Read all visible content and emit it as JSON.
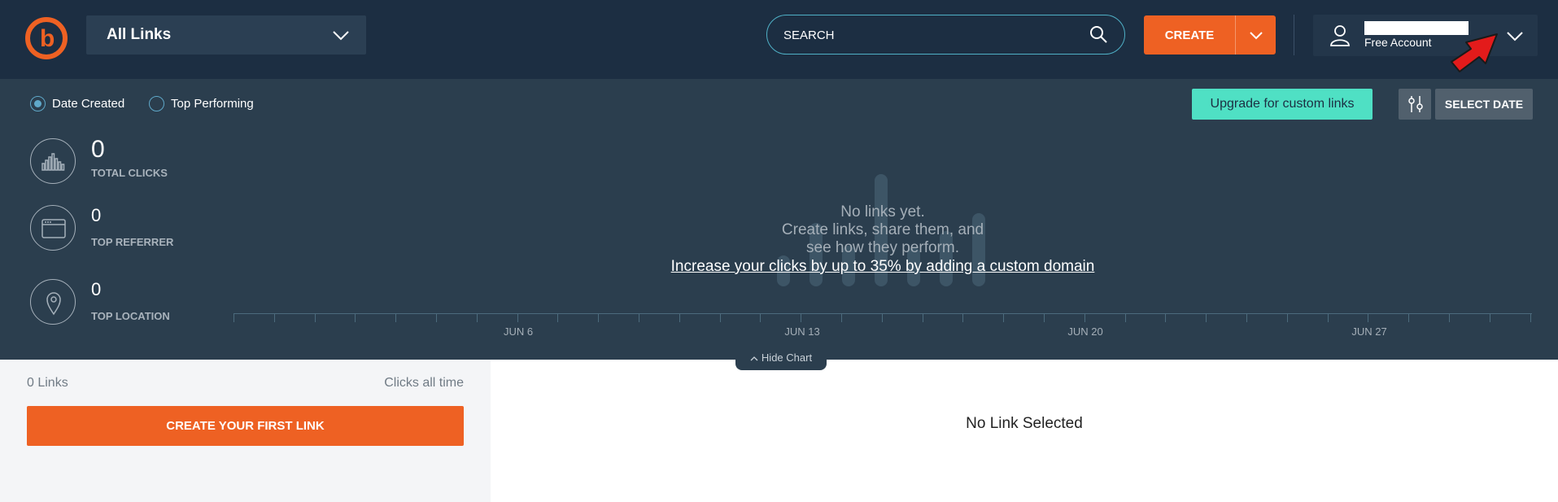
{
  "header": {
    "logo_icon": "bitly-logo-icon",
    "logo_letter": "b",
    "view_dropdown_label": "All Links",
    "search_placeholder": "SEARCH",
    "create_label": "CREATE",
    "account_plan": "Free Account"
  },
  "filters": {
    "date_created_label": "Date Created",
    "top_performing_label": "Top Performing",
    "selected": "Date Created",
    "upgrade_label": "Upgrade for custom links",
    "select_date_label": "SELECT DATE"
  },
  "stats": {
    "total_clicks_value": "0",
    "total_clicks_label": "TOTAL CLICKS",
    "top_referrer_value": "0",
    "top_referrer_label": "TOP REFERRER",
    "top_location_value": "0",
    "top_location_label": "TOP LOCATION"
  },
  "chart": {
    "empty_line1": "No links yet.",
    "empty_line2": "Create links, share them, and",
    "empty_line3": "see how they perform.",
    "domain_link": "Increase your clicks by up to 35% by adding a custom domain",
    "x_labels": [
      "JUN 6",
      "JUN 13",
      "JUN 20",
      "JUN 27"
    ],
    "hide_chart_label": "Hide Chart"
  },
  "links": {
    "count_label": "0 Links",
    "sort_label": "Clicks all time",
    "create_first_label": "CREATE YOUR FIRST LINK",
    "detail_empty": "No Link Selected"
  },
  "colors": {
    "header_bg": "#1c2e42",
    "panel_bg": "#2b3e4e",
    "accent_orange": "#ee6123",
    "upgrade_teal": "#4fe0c4"
  }
}
